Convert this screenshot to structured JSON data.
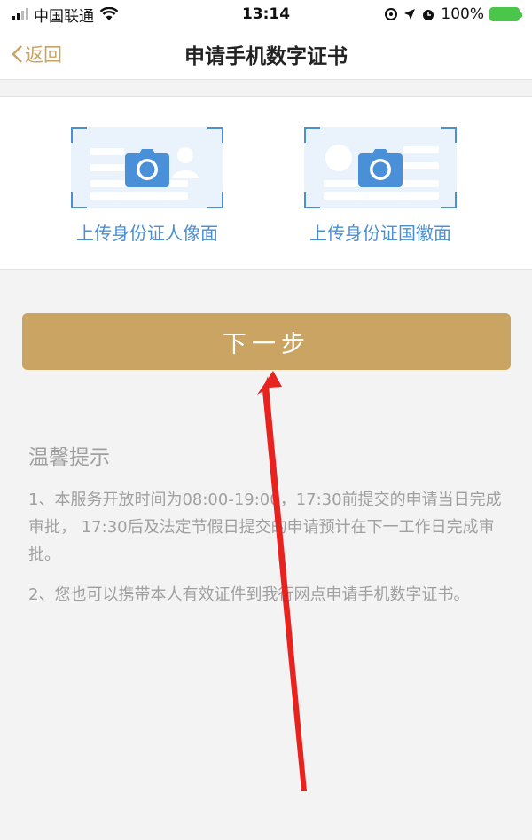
{
  "status_bar": {
    "carrier": "中国联通",
    "time": "13:14",
    "battery": "100%"
  },
  "nav": {
    "back_label": "返回",
    "title": "申请手机数字证书"
  },
  "upload": {
    "front_label": "上传身份证人像面",
    "back_label": "上传身份证国徽面"
  },
  "next_button": "下一步",
  "tips": {
    "title": "温馨提示",
    "items": [
      "1、本服务开放时间为08:00-19:00，17:30前提交的申请当日完成审批， 17:30后及法定节假日提交的申请预计在下一工作日完成审批。",
      "2、您也可以携带本人有效证件到我行网点申请手机数字证书。"
    ]
  },
  "colors": {
    "accent": "#c9a463",
    "link_blue": "#4a8fd4",
    "annotation_arrow": "#e8231f"
  },
  "icons": [
    "wifi-icon",
    "location-icon",
    "alarm-icon",
    "battery-icon",
    "camera-icon",
    "chevron-left-icon"
  ]
}
